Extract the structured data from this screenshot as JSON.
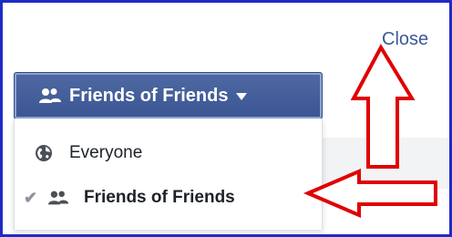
{
  "close_label": "Close",
  "privacy_button": {
    "icon": "friends-icon",
    "label": "Friends of Friends",
    "caret_icon": "caret-down-icon"
  },
  "menu": {
    "items": [
      {
        "label": "Everyone",
        "icon": "globe-icon",
        "selected": false
      },
      {
        "label": "Friends of Friends",
        "icon": "friends-icon",
        "selected": true
      }
    ]
  },
  "colors": {
    "frame_border": "#1f2bc4",
    "button_blue": "#3b5593",
    "link_blue": "#3b5998",
    "annotation_red": "#e00000"
  }
}
